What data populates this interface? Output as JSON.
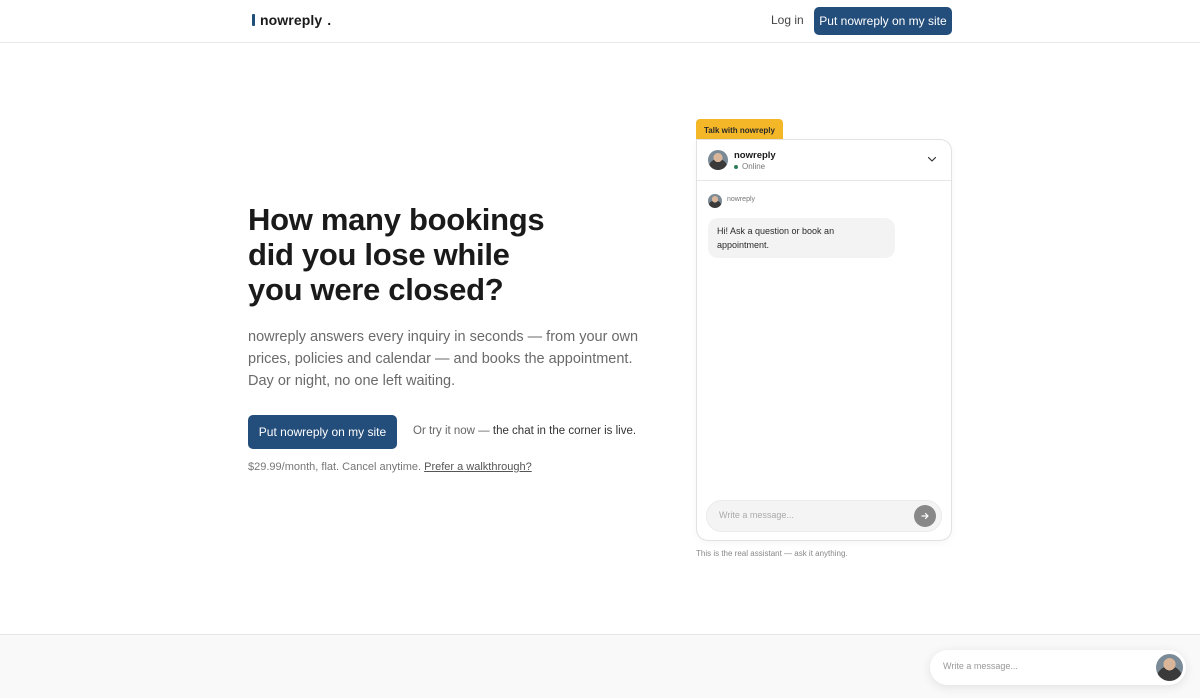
{
  "header": {
    "logo_text": "nowreply",
    "logo_suffix": ".",
    "login_label": "Log in",
    "cta_label": "Put nowreply on my site"
  },
  "hero": {
    "title_lines": [
      "How many bookings",
      "did you lose while",
      "you were closed?"
    ],
    "subtitle_lines": [
      "nowreply answers every inquiry in seconds — from your own",
      "prices, policies and calendar — and books the appointment.",
      "Day or night, no one left waiting."
    ],
    "cta_label": "Put nowreply on my site",
    "try_prefix": "Or try it now — ",
    "try_emphasis": "the chat in the corner is live.",
    "pricing_text": "$29.99/month, flat. Cancel anytime.",
    "walkthrough_link": "Prefer a walkthrough?"
  },
  "chat_widget": {
    "tab_label": "Talk with nowreply",
    "agent_name": "nowreply",
    "status": "Online",
    "message_sender": "nowreply",
    "message_text": "Hi! Ask a question or book an appointment.",
    "input_placeholder": "Write a message...",
    "note": "This is the real assistant — ask it anything."
  },
  "floating_chat": {
    "input_placeholder": "Write a message..."
  },
  "colors": {
    "brand": "#234d7a",
    "accent_tab": "#f4b728",
    "online": "#2d7d58"
  },
  "icons": {
    "chevron": "chevron-down-icon",
    "send": "send-arrow-icon",
    "avatar": "agent-avatar"
  }
}
